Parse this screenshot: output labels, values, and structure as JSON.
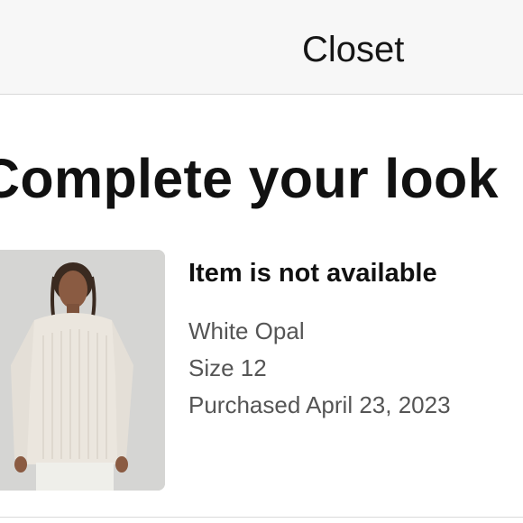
{
  "header": {
    "title": "Closet"
  },
  "section": {
    "title": "Complete your look"
  },
  "item": {
    "image": "woman wearing white knit sweater",
    "status": "Item is not available",
    "color": "White Opal",
    "size": "Size 12",
    "purchased": "Purchased April 23, 2023"
  }
}
